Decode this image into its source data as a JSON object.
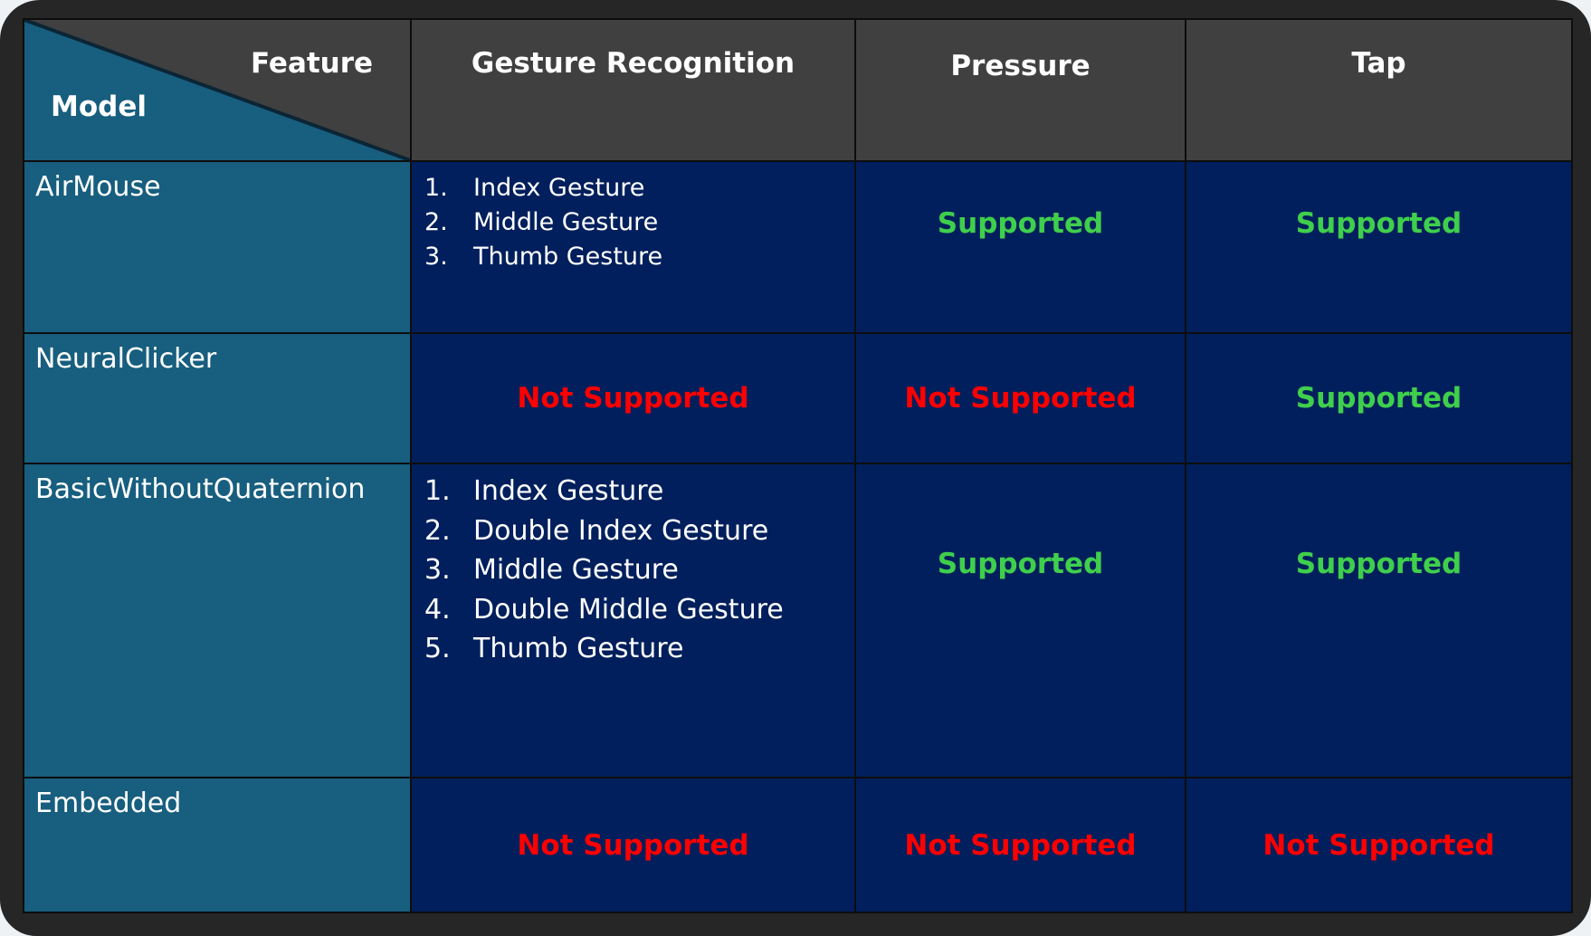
{
  "header": {
    "corner_top": "Feature",
    "corner_bottom": "Model",
    "columns": [
      "Gesture Recognition",
      "Pressure",
      "Tap"
    ]
  },
  "rows": [
    {
      "model": "AirMouse",
      "gestures": [
        "Index Gesture",
        "Middle Gesture",
        "Thumb Gesture"
      ],
      "pressure": "Supported",
      "tap": "Supported"
    },
    {
      "model": "NeuralClicker",
      "gesture_status": "Not Supported",
      "pressure": "Not Supported",
      "tap": "Supported"
    },
    {
      "model": "BasicWithoutQuaternion",
      "gestures": [
        "Index Gesture",
        "Double Index Gesture",
        "Middle Gesture",
        "Double Middle Gesture",
        "Thumb Gesture"
      ],
      "pressure": "Supported",
      "tap": "Supported"
    },
    {
      "model": "Embedded",
      "gesture_status": "Not Supported",
      "pressure": "Not Supported",
      "tap": "Not Supported"
    }
  ],
  "colors": {
    "supported": "#3fcf4c",
    "not_supported": "#ff0000",
    "model_col": "#175e7f",
    "data_cell": "#001f5c",
    "header": "#404040"
  }
}
